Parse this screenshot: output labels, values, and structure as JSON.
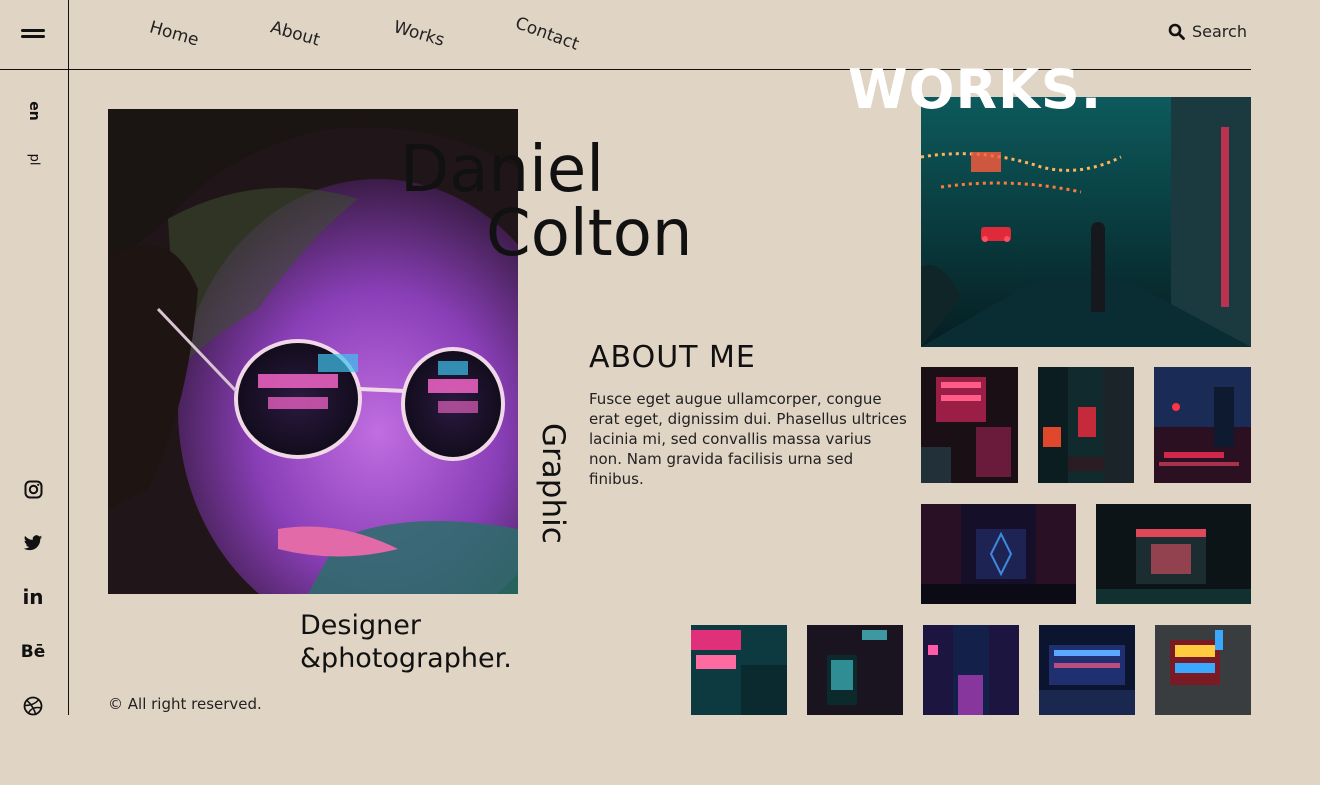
{
  "nav": {
    "home": "Home",
    "about": "About",
    "works": "Works",
    "contact": "Contact",
    "search_label": "Search"
  },
  "languages": [
    "en",
    "pl"
  ],
  "hero": {
    "first_name": "Daniel",
    "last_name": "Colton",
    "vertical_word": "Graphic",
    "role_line1": "Designer",
    "role_line2": "&photographer."
  },
  "about": {
    "title": "ABOUT ME",
    "text": "Fusce eget augue ullamcorper, congue erat eget, dignissim dui. Phasellus ultrices lacinia mi, sed convallis massa varius non. Nam gravida facilisis urna sed finibus."
  },
  "works": {
    "title": "WORKS."
  },
  "social": [
    "instagram-icon",
    "twitter-icon",
    "linkedin-icon",
    "behance-icon",
    "dribbble-icon"
  ],
  "behance_label": "Bē",
  "linkedin_label": "in",
  "footer": {
    "copyright": "© All right reserved."
  },
  "colors": {
    "background": "#e0d4c4",
    "text": "#111111",
    "works_title": "#ffffff"
  }
}
